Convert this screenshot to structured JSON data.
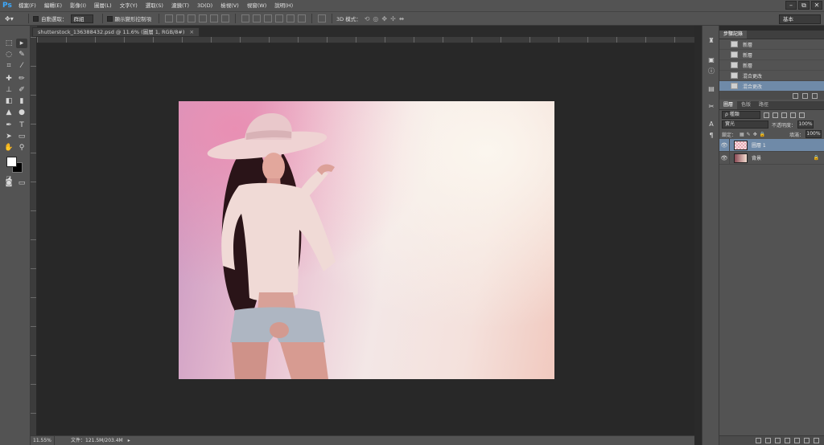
{
  "app": {
    "logo": "Ps"
  },
  "menu": [
    "檔案(F)",
    "編輯(E)",
    "影像(I)",
    "圖層(L)",
    "文字(Y)",
    "選取(S)",
    "濾鏡(T)",
    "3D(D)",
    "檢視(V)",
    "視窗(W)",
    "說明(H)"
  ],
  "window_controls": [
    "–",
    "⧉",
    "✕"
  ],
  "options": {
    "auto_select_label": "自動選取：",
    "auto_select_value": "群組",
    "show_transform_label": "顯示變形控制項",
    "mode_3d_label": "3D 模式：",
    "workspace": "基本"
  },
  "document": {
    "tab_title": "shutterstock_136388432.psd @ 11.6% (圖層 1, RGB/8#)",
    "tab_close": "×",
    "zoom": "11.55%",
    "status": "文件：121.5M/203.4M",
    "status_arrow": "▸"
  },
  "history_panel": {
    "tabs": [
      "步驟記錄"
    ],
    "items": [
      {
        "label": "新層",
        "selected": false
      },
      {
        "label": "新層",
        "selected": false
      },
      {
        "label": "新層",
        "selected": false
      },
      {
        "label": "混合更改",
        "selected": false
      },
      {
        "label": "混合更改",
        "selected": true
      }
    ]
  },
  "layers_panel": {
    "tabs": [
      "圖層",
      "色版",
      "路徑"
    ],
    "filter_kind": "ρ 種類",
    "blend_mode": "實光",
    "opacity_label": "不透明度：",
    "opacity_value": "100%",
    "lock_label": "鎖定：",
    "fill_label": "填滿：",
    "fill_value": "100%",
    "layers": [
      {
        "name": "圖層 1",
        "selected": true,
        "locked": false,
        "eye": "👁",
        "lock_icon": ""
      },
      {
        "name": "背景",
        "selected": false,
        "locked": true,
        "eye": "👁",
        "lock_icon": "🔒"
      }
    ]
  },
  "colors": {
    "foreground": "#ffffff",
    "background": "#000000",
    "selection": "#6f8aa8",
    "ps_blue": "#3da9fc"
  }
}
